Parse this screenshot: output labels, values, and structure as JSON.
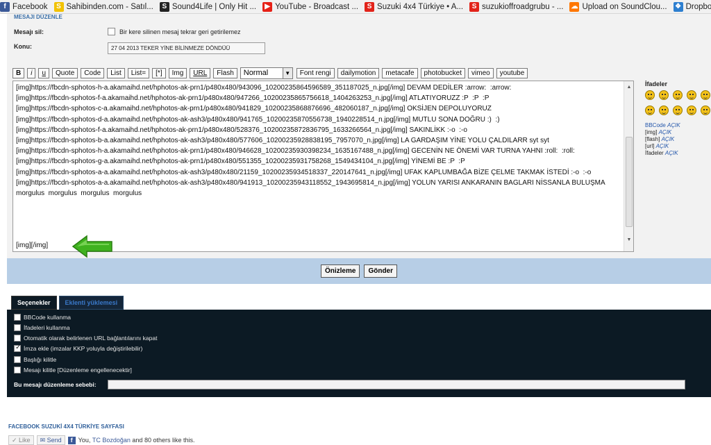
{
  "bookmarks": [
    {
      "label": "Facebook",
      "icon": "facebook-icon",
      "color": "#3b5998",
      "glyph": "f"
    },
    {
      "label": "Sahibinden.com - Satıl...",
      "icon": "sahibinden-icon",
      "color": "#f2c200",
      "glyph": "S"
    },
    {
      "label": "Sound4Life | Only Hit ...",
      "icon": "sound4life-icon",
      "color": "#222222",
      "glyph": "S"
    },
    {
      "label": "YouTube - Broadcast ...",
      "icon": "youtube-icon",
      "color": "#e62117",
      "glyph": "▶"
    },
    {
      "label": "Suzuki 4x4 Türkiye • A...",
      "icon": "suzuki-icon",
      "color": "#e2231a",
      "glyph": "S"
    },
    {
      "label": "suzukioffroadgrubu - ...",
      "icon": "suzuki-icon",
      "color": "#e2231a",
      "glyph": "S"
    },
    {
      "label": "Upload on SoundClou...",
      "icon": "soundcloud-icon",
      "color": "#ff7700",
      "glyph": "☁"
    },
    {
      "label": "Dropbox - IMAG",
      "icon": "dropbox-icon",
      "color": "#2d7fd0",
      "glyph": "❖"
    }
  ],
  "edit": {
    "section_title": "MESAJI DÜZENLE",
    "delete_label": "Mesajı sil:",
    "delete_text": "Bir kere silinen mesaj tekrar geri getirilemez",
    "subject_label": "Konu:",
    "subject_value": "27 04 2013 TEKER YİNE BİLİNMEZE DÖNDÜÜ"
  },
  "toolbar": {
    "bold": "B",
    "italic": "i",
    "underline": "u",
    "buttons": [
      "Quote",
      "Code",
      "List",
      "List=",
      "[*]",
      "Img",
      "URL",
      "Flash"
    ],
    "size_select": "Normal",
    "buttons2": [
      "Font rengi",
      "dailymotion",
      "metacafe",
      "photobucket",
      "vimeo",
      "youtube"
    ]
  },
  "message_lines": [
    "[img]https://fbcdn-sphotos-h-a.akamaihd.net/hphotos-ak-prn1/p480x480/943096_10200235864596589_351187025_n.jpg[/img] DEVAM DEDİLER :arrow:  :arrow:",
    "[img]https://fbcdn-sphotos-f-a.akamaihd.net/hphotos-ak-prn1/p480x480/947266_10200235865756618_1404263253_n.jpg[/img] ATLATIYORUZZ :P  :P  :P",
    "[img]https://fbcdn-sphotos-c-a.akamaihd.net/hphotos-ak-prn1/p480x480/941829_10200235868876696_482060187_n.jpg[/img] OKSİJEN DEPOLUYORUZ",
    "[img]https://fbcdn-sphotos-d-a.akamaihd.net/hphotos-ak-ash3/p480x480/941765_10200235870556738_1940228514_n.jpg[/img] MUTLU SONA DOĞRU :)  :)",
    "[img]https://fbcdn-sphotos-f-a.akamaihd.net/hphotos-ak-prn1/p480x480/528376_10200235872836795_1633266564_n.jpg[/img] SAKINLİKK :-o  :-o",
    "[img]https://fbcdn-sphotos-b-a.akamaihd.net/hphotos-ak-ash3/p480x480/577606_10200235928838195_7957070_n.jpg[/img] LA GARDAŞIM YİNE YOLU ÇALDILARR syt syt",
    "[img]https://fbcdn-sphotos-h-a.akamaihd.net/hphotos-ak-prn1/p480x480/946628_10200235930398234_1635167488_n.jpg[/img] GECENİN NE ÖNEMİ VAR TURNA YAHNI :roll:  :roll:",
    "[img]https://fbcdn-sphotos-g-a.akamaihd.net/hphotos-ak-prn1/p480x480/551355_10200235931758268_1549434104_n.jpg[/img] YİNEMİ BE :P  :P",
    "[img]https://fbcdn-sphotos-a-a.akamaihd.net/hphotos-ak-ash3/p480x480/21159_10200235934518337_220147641_n.jpg[/img] UFAK KAPLUMBAĞA BİZE ÇELME TAKMAK İSTEDİ :-o  :-o",
    "[img]https://fbcdn-sphotos-a-a.akamaihd.net/hphotos-ak-ash3/p480x480/941913_10200235943118552_1943695814_n.jpg[/img] YOLUN YARISI ANKARANIN BAGLARI NİSSANLA BULUŞMA morgulus  morgulus  morgulus  morgulus"
  ],
  "current_line": "[img][/img]",
  "smilies": {
    "title": "İfadeler",
    "icons": [
      "grin-smiley-icon",
      "sad-smiley-icon",
      "surprised-smiley-icon",
      "smile-smiley-icon",
      "cool-smiley-icon",
      "confused-smiley-icon",
      "eek-smiley-icon",
      "arrow-smiley-icon",
      "neutral-smiley-icon",
      "mad-smiley-icon"
    ],
    "bbcode_label": "BBCode",
    "bbcode_state": "AÇIK",
    "img_label": "[img]",
    "img_state": "AÇIK",
    "flash_label": "[flash]",
    "flash_state": "AÇIK",
    "url_label": "[url]",
    "url_state": "AÇIK",
    "ifadeler_label": "İfadeler",
    "ifadeler_state": "AÇIK"
  },
  "submit": {
    "preview": "Önizleme",
    "send": "Gönder"
  },
  "options": {
    "tab_active": "Seçenekler",
    "tab_inactive": "Eklenti yüklemesi",
    "items": [
      {
        "label": "BBCode kullanma",
        "checked": false
      },
      {
        "label": "İfadeleri kullanma",
        "checked": false
      },
      {
        "label": "Otomatik olarak belirlenen URL bağlantılarını kapat",
        "checked": false
      },
      {
        "label": "İmza ekle (imzalar KKP yoluyla değiştirilebilir)",
        "checked": true
      },
      {
        "label": "Başlığı kilitle",
        "checked": false
      },
      {
        "label": "Mesajı kilitle [Düzenleme engellenecektir]",
        "checked": false
      }
    ],
    "reason_label": "Bu mesajı düzenleme sebebi:",
    "reason_value": ""
  },
  "footer": {
    "title": "FACEBOOK SUZUKİ 4X4 TÜRKİYE SAYFASI",
    "like": "Like",
    "send": "Send",
    "you": "You,",
    "friend": "TC Bozdoğan",
    "others": "and 80 others like this."
  },
  "colors": {
    "accent_blue": "#b7cee6",
    "dark_panel": "#0c1a24",
    "arrow_green": "#3fb21f"
  }
}
